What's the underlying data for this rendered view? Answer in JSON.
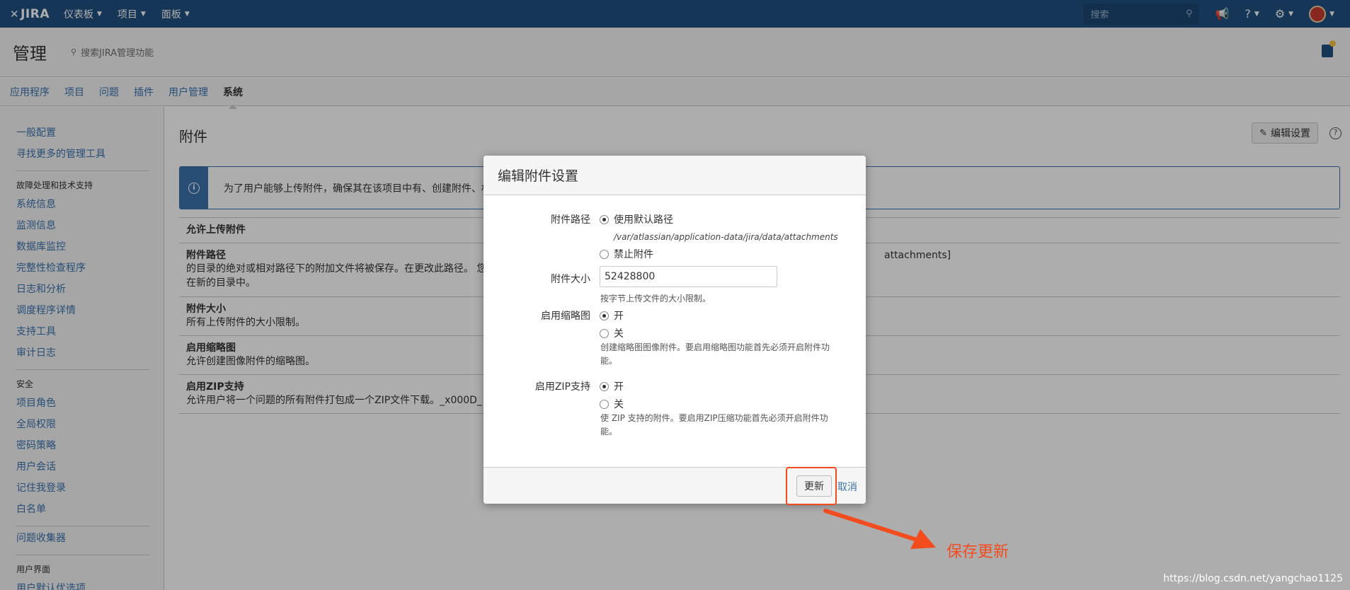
{
  "topnav": {
    "logo_mark": "✕",
    "logo": "JIRA",
    "menu": [
      "仪表板",
      "项目",
      "面板"
    ],
    "search_placeholder": "搜索"
  },
  "admin": {
    "title": "管理",
    "search": "搜索JIRA管理功能"
  },
  "tabs": [
    "应用程序",
    "项目",
    "问题",
    "插件",
    "用户管理",
    "系统"
  ],
  "sidebar": {
    "g1": [
      "一般配置",
      "寻找更多的管理工具"
    ],
    "h2": "故障处理和技术支持",
    "g2": [
      "系统信息",
      "监测信息",
      "数据库监控",
      "完整性检查程序",
      "日志和分析",
      "调度程序详情",
      "支持工具",
      "审计日志"
    ],
    "h3": "安全",
    "g3": [
      "项目角色",
      "全局权限",
      "密码策略",
      "用户会话",
      "记住我登录",
      "白名单"
    ],
    "g4": [
      "问题收集器"
    ],
    "h5": "用户界面",
    "g5": [
      "用户默认优选项"
    ]
  },
  "page": {
    "title": "附件",
    "edit_button": "编辑设置",
    "info": "为了用户能够上传附件，确保其在该项目中有、创建附件、权",
    "rows": [
      {
        "name": "允许上传附件",
        "desc": ""
      },
      {
        "name": "附件路径",
        "desc": "的目录的绝对或相对路径下的附加文件将被保存。在更改此路径。 您",
        "desc2": "在新的目录中。",
        "val": "attachments]"
      },
      {
        "name": "附件大小",
        "desc": "所有上传附件的大小限制。"
      },
      {
        "name": "启用缩略图",
        "desc": "允许创建图像附件的缩略图。"
      },
      {
        "name": "启用ZIP支持",
        "desc": "允许用户将一个问题的所有附件打包成一个ZIP文件下载。_x000D_"
      }
    ]
  },
  "dialog": {
    "title": "编辑附件设置",
    "path_label": "附件路径",
    "path_default": "使用默认路径",
    "path_value": "/var/atlassian/application-data/jira/data/attachments",
    "path_disable": "禁止附件",
    "size_label": "附件大小",
    "size_value": "52428800",
    "size_hint": "按字节上传文件的大小限制。",
    "thumb_label": "启用缩略图",
    "on": "开",
    "off": "关",
    "thumb_hint": "创建缩略图图像附件。要启用缩略图功能首先必须开启附件功能。",
    "zip_label": "启用ZIP支持",
    "zip_hint": "使 ZIP 支持的附件。要启用ZIP压缩功能首先必须开启附件功能。",
    "update": "更新",
    "cancel": "取消"
  },
  "annotation": {
    "text": "保存更新",
    "color": "#f24c1f"
  },
  "watermark": "https://blog.csdn.net/yangchao1125"
}
